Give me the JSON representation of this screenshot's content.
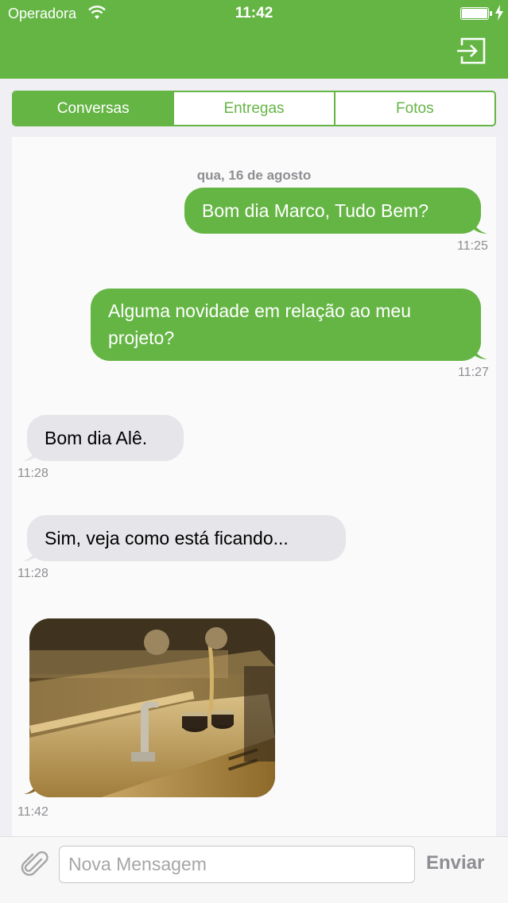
{
  "status_bar": {
    "carrier": "Operadora",
    "time": "11:42"
  },
  "header": {
    "logout_icon": "logout-icon"
  },
  "tabs": [
    {
      "label": "Conversas",
      "active": true
    },
    {
      "label": "Entregas",
      "active": false
    },
    {
      "label": "Fotos",
      "active": false
    }
  ],
  "chat": {
    "date": "qua, 16 de agosto",
    "messages": [
      {
        "direction": "out",
        "text": "Bom dia Marco, Tudo Bem?",
        "time": "11:25"
      },
      {
        "direction": "out",
        "text_line1": "Alguma novidade em relação ao meu",
        "text_line2": "projeto?",
        "time": "11:27"
      },
      {
        "direction": "in",
        "text": "Bom dia Alê.",
        "time": "11:28"
      },
      {
        "direction": "in",
        "text": "Sim, veja como está ficando...",
        "time": "11:28"
      },
      {
        "direction": "in",
        "type": "image",
        "image": "bathroom-sink-photo",
        "time": "11:42"
      }
    ]
  },
  "composer": {
    "attach_icon": "paperclip-icon",
    "placeholder": "Nova Mensagem",
    "send_label": "Enviar"
  },
  "colors": {
    "brand_green": "#65b545",
    "incoming_bubble": "#e5e5ea"
  }
}
